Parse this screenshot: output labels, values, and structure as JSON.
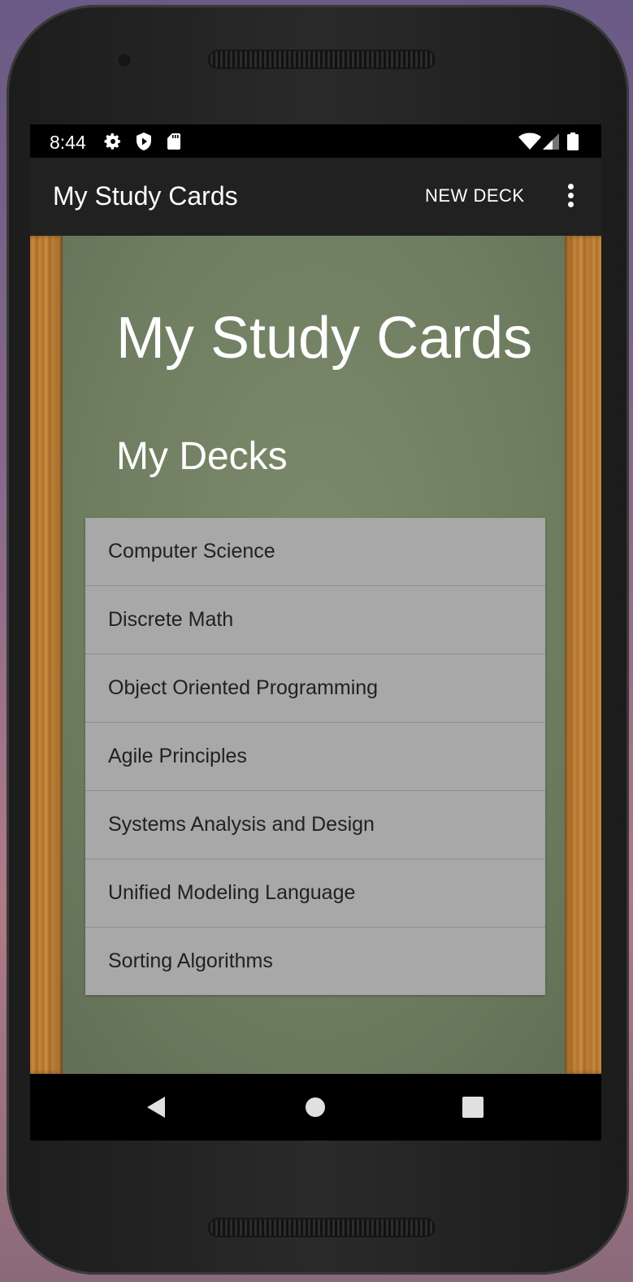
{
  "status_bar": {
    "time": "8:44",
    "left_icons": [
      "settings-icon",
      "shield-play-icon",
      "sd-card-icon"
    ],
    "right_icons": [
      "wifi-icon",
      "cell-signal-icon",
      "battery-icon"
    ]
  },
  "app_bar": {
    "title": "My Study Cards",
    "action_label": "NEW DECK",
    "overflow_icon": "more-vert-icon"
  },
  "main": {
    "heading": "My Study Cards",
    "subheading": "My Decks",
    "decks": [
      "Computer Science",
      "Discrete Math",
      "Object Oriented Programming",
      "Agile Principles",
      "Systems Analysis and Design",
      "Unified Modeling Language",
      "Sorting Algorithms"
    ]
  },
  "nav_bar": {
    "buttons": [
      "back-icon",
      "home-icon",
      "recents-icon"
    ]
  },
  "colors": {
    "app_bar": "#212121",
    "chalkboard": "#6f7e60",
    "wood": "#b5772f",
    "list_background": "#a8a8a8"
  }
}
